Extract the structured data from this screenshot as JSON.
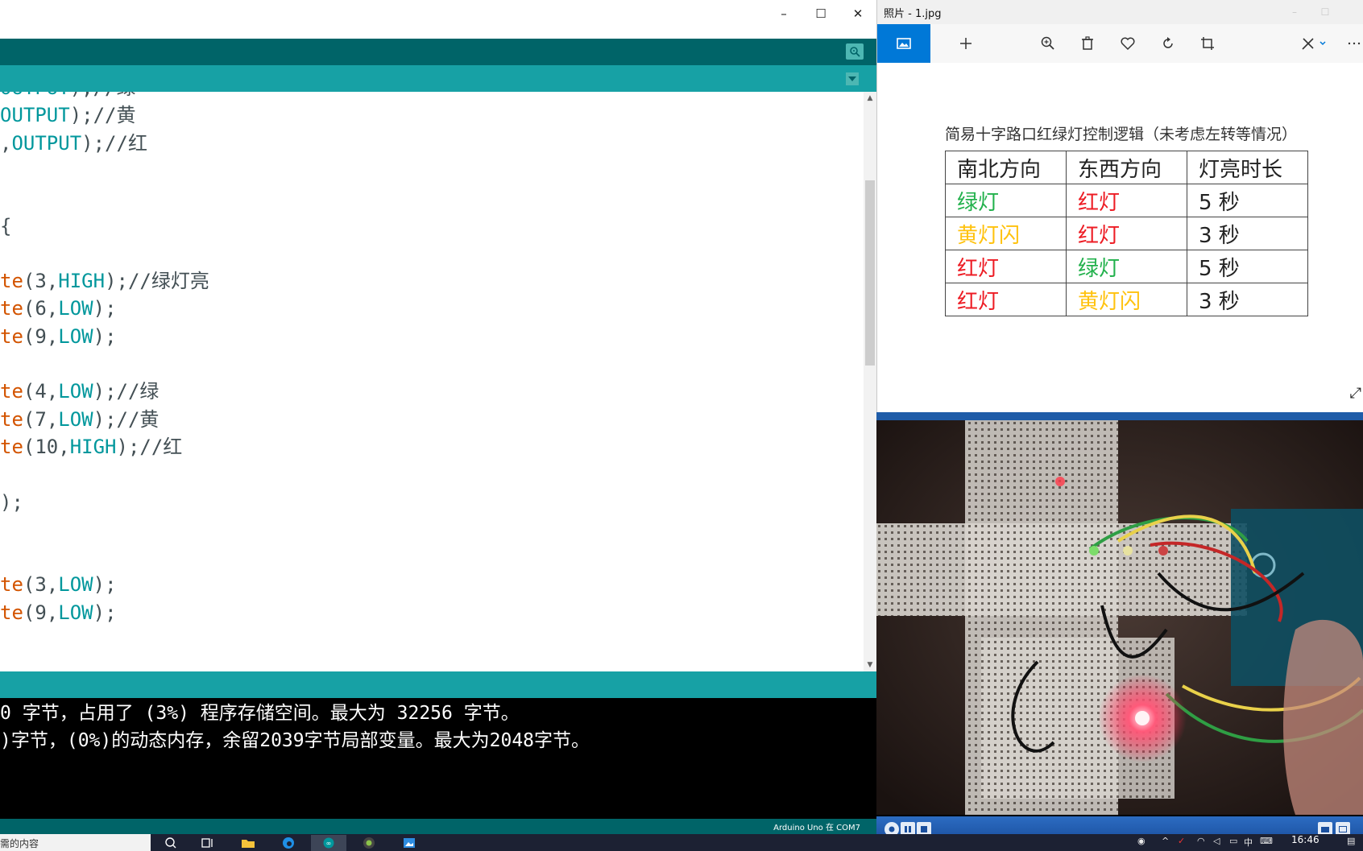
{
  "ide": {
    "code_lines": [
      {
        "parts": [
          {
            "t": "OUTPUT",
            "c": "kw"
          },
          {
            "t": ");//绿"
          }
        ]
      },
      {
        "parts": [
          {
            "t": "OUTPUT",
            "c": "kw"
          },
          {
            "t": ");//黄"
          }
        ]
      },
      {
        "parts": [
          {
            "t": ","
          },
          {
            "t": "OUTPUT",
            "c": "kw"
          },
          {
            "t": ");//红"
          }
        ]
      },
      {
        "parts": [
          {
            "t": ""
          }
        ]
      },
      {
        "parts": [
          {
            "t": ""
          }
        ]
      },
      {
        "parts": [
          {
            "t": "{"
          }
        ]
      },
      {
        "parts": [
          {
            "t": ""
          }
        ]
      },
      {
        "parts": [
          {
            "t": "te",
            "c": "fn"
          },
          {
            "t": "(3,"
          },
          {
            "t": "HIGH",
            "c": "kw"
          },
          {
            "t": ");//绿灯亮"
          }
        ]
      },
      {
        "parts": [
          {
            "t": "te",
            "c": "fn"
          },
          {
            "t": "(6,"
          },
          {
            "t": "LOW",
            "c": "kw"
          },
          {
            "t": ");"
          }
        ]
      },
      {
        "parts": [
          {
            "t": "te",
            "c": "fn"
          },
          {
            "t": "(9,"
          },
          {
            "t": "LOW",
            "c": "kw"
          },
          {
            "t": ");"
          }
        ]
      },
      {
        "parts": [
          {
            "t": ""
          }
        ]
      },
      {
        "parts": [
          {
            "t": "te",
            "c": "fn"
          },
          {
            "t": "(4,"
          },
          {
            "t": "LOW",
            "c": "kw"
          },
          {
            "t": ");//绿"
          }
        ]
      },
      {
        "parts": [
          {
            "t": "te",
            "c": "fn"
          },
          {
            "t": "(7,"
          },
          {
            "t": "LOW",
            "c": "kw"
          },
          {
            "t": ");//黄"
          }
        ]
      },
      {
        "parts": [
          {
            "t": "te",
            "c": "fn"
          },
          {
            "t": "(10,"
          },
          {
            "t": "HIGH",
            "c": "kw"
          },
          {
            "t": ");//红"
          }
        ]
      },
      {
        "parts": [
          {
            "t": ""
          }
        ]
      },
      {
        "parts": [
          {
            "t": ");"
          }
        ]
      },
      {
        "parts": [
          {
            "t": ""
          }
        ]
      },
      {
        "parts": [
          {
            "t": ""
          }
        ]
      },
      {
        "parts": [
          {
            "t": "te",
            "c": "fn"
          },
          {
            "t": "(3,"
          },
          {
            "t": "LOW",
            "c": "kw"
          },
          {
            "t": ");"
          }
        ]
      },
      {
        "parts": [
          {
            "t": "te",
            "c": "fn"
          },
          {
            "t": "(9,"
          },
          {
            "t": "LOW",
            "c": "kw"
          },
          {
            "t": ");"
          }
        ]
      }
    ],
    "console_lines": [
      "0 字节，占用了 (3%) 程序存储空间。最大为 32256 字节。",
      ")字节，(0%)的动态内存，余留2039字节局部变量。最大为2048字节。"
    ],
    "board_status": "Arduino Uno 在 COM7",
    "window_controls": {
      "minimize": "–",
      "maximize": "☐",
      "close": "✕"
    }
  },
  "photos": {
    "window_title": "照片 - 1.jpg",
    "image_title": "简易十字路口红绿灯控制逻辑（未考虑左转等情况）",
    "table": {
      "headers": [
        "南北方向",
        "东西方向",
        "灯亮时长"
      ],
      "rows": [
        [
          {
            "text": "绿灯",
            "color": "green"
          },
          {
            "text": "红灯",
            "color": "red"
          },
          {
            "text": "5 秒",
            "color": "black"
          }
        ],
        [
          {
            "text": "黄灯闪",
            "color": "yellow"
          },
          {
            "text": "红灯",
            "color": "red"
          },
          {
            "text": "3 秒",
            "color": "black"
          }
        ],
        [
          {
            "text": "红灯",
            "color": "red"
          },
          {
            "text": "绿灯",
            "color": "green"
          },
          {
            "text": "5 秒",
            "color": "black"
          }
        ],
        [
          {
            "text": "红灯",
            "color": "red"
          },
          {
            "text": "黄灯闪",
            "color": "yellow"
          },
          {
            "text": "3 秒",
            "color": "black"
          }
        ]
      ]
    },
    "toolbar": [
      "collection-icon",
      "add-icon",
      "zoom-icon",
      "delete-icon",
      "favorite-icon",
      "rotate-icon",
      "crop-icon",
      "edit-icon",
      "more-icon"
    ]
  },
  "taskbar": {
    "search_placeholder": "需的内容",
    "clock_time": "16:46",
    "tray_text": "中"
  },
  "colors": {
    "ide_dark_teal": "#006468",
    "ide_teal": "#17a1a5",
    "code_function": "#d35400",
    "code_keyword": "#00979c",
    "photos_accent": "#0078d7",
    "green_light": "#22b14c",
    "red_light": "#ed1c24",
    "yellow_light": "#ffc20e"
  }
}
